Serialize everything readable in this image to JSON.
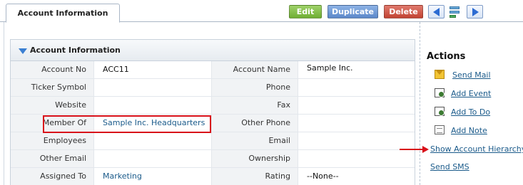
{
  "tab": {
    "label": "Account Information"
  },
  "toolbar": {
    "edit_label": "Edit",
    "duplicate_label": "Duplicate",
    "delete_label": "Delete",
    "edit_color": "#7dbb43",
    "duplicate_color": "#6a97d8",
    "delete_color": "#d35a4b"
  },
  "panel": {
    "title": "Account Information"
  },
  "fields": [
    {
      "label1": "Account No",
      "value1": "ACC11",
      "label2": "Account Name",
      "value2": "Sample Inc."
    },
    {
      "label1": "Ticker Symbol",
      "value1": "",
      "label2": "Phone",
      "value2": ""
    },
    {
      "label1": "Website",
      "value1": "",
      "label2": "Fax",
      "value2": ""
    },
    {
      "label1": "Member Of",
      "value1": "Sample Inc. Headquarters",
      "label2": "Other Phone",
      "value2": ""
    },
    {
      "label1": "Employees",
      "value1": "",
      "label2": "Email",
      "value2": ""
    },
    {
      "label1": "Other Email",
      "value1": "",
      "label2": "Ownership",
      "value2": ""
    },
    {
      "label1": "Assigned To",
      "value1": "Marketing",
      "label2": "Rating",
      "value2": "--None--"
    }
  ],
  "actions": {
    "title": "Actions",
    "items": [
      {
        "label": "Send Mail",
        "icon": "mail-icon"
      },
      {
        "label": "Add Event",
        "icon": "event-icon"
      },
      {
        "label": "Add To Do",
        "icon": "todo-icon"
      },
      {
        "label": "Add Note",
        "icon": "note-icon"
      },
      {
        "label": "Show Account Hierarchy",
        "icon": ""
      },
      {
        "label": "Send SMS",
        "icon": ""
      }
    ]
  },
  "colors": {
    "highlight": "#d8101a",
    "link": "#1a5a8a",
    "accent": "#3a7fd2"
  }
}
